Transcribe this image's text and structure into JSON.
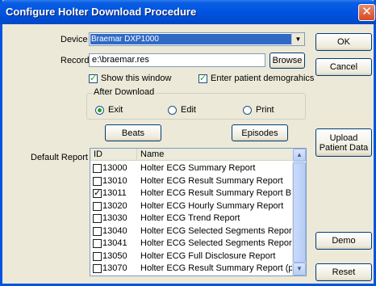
{
  "window": {
    "title": "Configure Holter Download Procedure"
  },
  "device": {
    "label": "Device",
    "value": "Braemar DXP1000"
  },
  "record": {
    "label": "Record",
    "value": "e:\\braemar.res",
    "browse": "Browse"
  },
  "options": {
    "show_window": {
      "label": "Show this window",
      "checked": true
    },
    "enter_demographics": {
      "label": "Enter patient demograhics",
      "checked": true
    }
  },
  "after_download": {
    "label": "After Download",
    "options": [
      {
        "label": "Exit",
        "selected": true
      },
      {
        "label": "Edit",
        "selected": false
      },
      {
        "label": "Print",
        "selected": false
      }
    ]
  },
  "buttons": {
    "beats": "Beats",
    "episodes": "Episodes",
    "ok": "OK",
    "cancel": "Cancel",
    "upload_line1": "Upload",
    "upload_line2": "Patient Data",
    "demo": "Demo",
    "reset": "Reset"
  },
  "default_report": {
    "label": "Default Report",
    "columns": [
      "ID",
      "Name"
    ],
    "rows": [
      {
        "id": "13000",
        "name": "Holter ECG Summary Report",
        "checked": false
      },
      {
        "id": "13010",
        "name": "Holter ECG Result Summary Report",
        "checked": false
      },
      {
        "id": "13011",
        "name": "Holter ECG Result Summary Report B",
        "checked": true
      },
      {
        "id": "13020",
        "name": "Holter ECG Hourly Summary Report",
        "checked": false
      },
      {
        "id": "13030",
        "name": "Holter ECG Trend Report",
        "checked": false
      },
      {
        "id": "13040",
        "name": "Holter ECG Selected Segments Report",
        "checked": false
      },
      {
        "id": "13041",
        "name": "Holter ECG Selected Segments Report",
        "checked": false
      },
      {
        "id": "13050",
        "name": "Holter ECG Full Disclosure Report",
        "checked": false
      },
      {
        "id": "13070",
        "name": "Holter ECG Result Summary Report (pa...",
        "checked": false
      }
    ]
  }
}
